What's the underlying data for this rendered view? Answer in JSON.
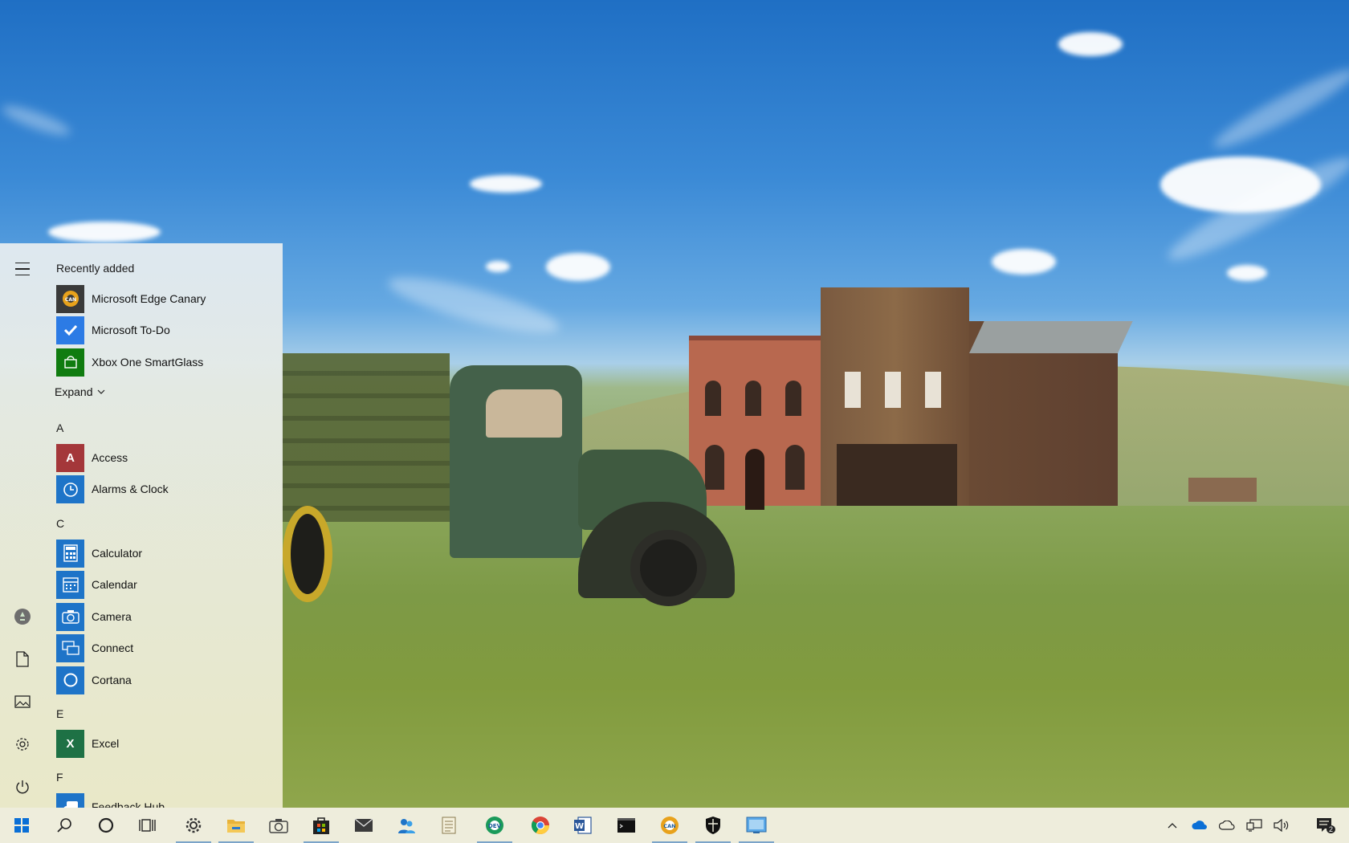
{
  "start_menu": {
    "recently_added_label": "Recently added",
    "recent_apps": [
      {
        "label": "Microsoft Edge Canary",
        "icon": "edge-canary-icon",
        "color": "#3a3a3a"
      },
      {
        "label": "Microsoft To-Do",
        "icon": "todo-icon",
        "color": "#2c7be5"
      },
      {
        "label": "Xbox One SmartGlass",
        "icon": "xbox-icon",
        "color": "#107c10"
      }
    ],
    "expand_label": "Expand",
    "groups": [
      {
        "letter": "A",
        "apps": [
          {
            "label": "Access",
            "icon": "access-icon",
            "color": "#a4373a",
            "glyph": "A"
          },
          {
            "label": "Alarms & Clock",
            "icon": "alarm-clock-icon",
            "color": "#1e74c8",
            "glyph": "⏰"
          }
        ]
      },
      {
        "letter": "C",
        "apps": [
          {
            "label": "Calculator",
            "icon": "calculator-icon",
            "color": "#1e74c8",
            "glyph": "▦"
          },
          {
            "label": "Calendar",
            "icon": "calendar-icon",
            "color": "#1e74c8",
            "glyph": "▤"
          },
          {
            "label": "Camera",
            "icon": "camera-icon",
            "color": "#1e74c8",
            "glyph": "◉"
          },
          {
            "label": "Connect",
            "icon": "connect-icon",
            "color": "#1e74c8",
            "glyph": "⧉"
          },
          {
            "label": "Cortana",
            "icon": "cortana-icon",
            "color": "#1e74c8",
            "glyph": "○"
          }
        ]
      },
      {
        "letter": "E",
        "apps": [
          {
            "label": "Excel",
            "icon": "excel-icon",
            "color": "#1e7145",
            "glyph": "X"
          }
        ]
      },
      {
        "letter": "F",
        "apps": [
          {
            "label": "Feedback Hub",
            "icon": "feedback-hub-icon",
            "color": "#1e74c8",
            "glyph": "◧"
          }
        ]
      }
    ],
    "rail": [
      "menu-icon",
      "user-icon",
      "documents-icon",
      "pictures-icon",
      "settings-icon",
      "power-icon"
    ]
  },
  "taskbar": {
    "background": "#eeeddc",
    "pinned": [
      {
        "name": "start-button",
        "icon": "windows-icon"
      },
      {
        "name": "search-button",
        "icon": "search-icon"
      },
      {
        "name": "cortana-button",
        "icon": "cortana-circle-icon"
      },
      {
        "name": "task-view-button",
        "icon": "task-view-icon"
      },
      {
        "name": "settings-app",
        "icon": "settings-gear-icon"
      },
      {
        "name": "file-explorer-app",
        "icon": "folder-icon"
      },
      {
        "name": "camera-app",
        "icon": "camera-taskbar-icon"
      },
      {
        "name": "store-app",
        "icon": "store-icon"
      },
      {
        "name": "mail-app",
        "icon": "mail-icon"
      },
      {
        "name": "people-app",
        "icon": "people-icon"
      },
      {
        "name": "notepad-app",
        "icon": "notepad-icon"
      },
      {
        "name": "edge-dev-app",
        "icon": "edge-dev-icon"
      },
      {
        "name": "chrome-app",
        "icon": "chrome-icon"
      },
      {
        "name": "word-app",
        "icon": "word-icon"
      },
      {
        "name": "terminal-app",
        "icon": "terminal-icon"
      },
      {
        "name": "edge-canary-app",
        "icon": "edge-canary-taskbar-icon"
      },
      {
        "name": "security-app",
        "icon": "shield-icon"
      },
      {
        "name": "remote-desktop-app",
        "icon": "remote-desktop-icon"
      }
    ],
    "notification_count": "2"
  }
}
